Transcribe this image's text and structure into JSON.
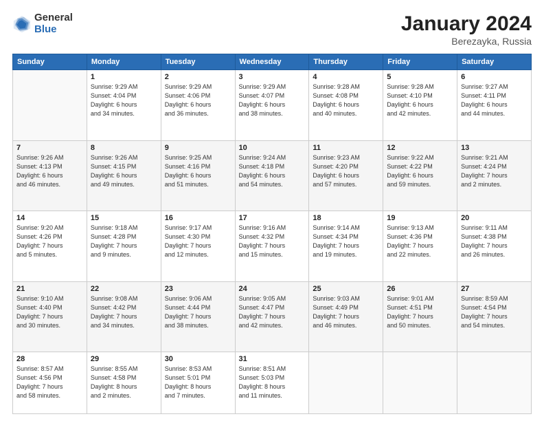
{
  "header": {
    "logo_general": "General",
    "logo_blue": "Blue",
    "title": "January 2024",
    "location": "Berezayka, Russia"
  },
  "days_of_week": [
    "Sunday",
    "Monday",
    "Tuesday",
    "Wednesday",
    "Thursday",
    "Friday",
    "Saturday"
  ],
  "weeks": [
    [
      {
        "day": "",
        "info": ""
      },
      {
        "day": "1",
        "info": "Sunrise: 9:29 AM\nSunset: 4:04 PM\nDaylight: 6 hours\nand 34 minutes."
      },
      {
        "day": "2",
        "info": "Sunrise: 9:29 AM\nSunset: 4:06 PM\nDaylight: 6 hours\nand 36 minutes."
      },
      {
        "day": "3",
        "info": "Sunrise: 9:29 AM\nSunset: 4:07 PM\nDaylight: 6 hours\nand 38 minutes."
      },
      {
        "day": "4",
        "info": "Sunrise: 9:28 AM\nSunset: 4:08 PM\nDaylight: 6 hours\nand 40 minutes."
      },
      {
        "day": "5",
        "info": "Sunrise: 9:28 AM\nSunset: 4:10 PM\nDaylight: 6 hours\nand 42 minutes."
      },
      {
        "day": "6",
        "info": "Sunrise: 9:27 AM\nSunset: 4:11 PM\nDaylight: 6 hours\nand 44 minutes."
      }
    ],
    [
      {
        "day": "7",
        "info": "Sunrise: 9:26 AM\nSunset: 4:13 PM\nDaylight: 6 hours\nand 46 minutes."
      },
      {
        "day": "8",
        "info": "Sunrise: 9:26 AM\nSunset: 4:15 PM\nDaylight: 6 hours\nand 49 minutes."
      },
      {
        "day": "9",
        "info": "Sunrise: 9:25 AM\nSunset: 4:16 PM\nDaylight: 6 hours\nand 51 minutes."
      },
      {
        "day": "10",
        "info": "Sunrise: 9:24 AM\nSunset: 4:18 PM\nDaylight: 6 hours\nand 54 minutes."
      },
      {
        "day": "11",
        "info": "Sunrise: 9:23 AM\nSunset: 4:20 PM\nDaylight: 6 hours\nand 57 minutes."
      },
      {
        "day": "12",
        "info": "Sunrise: 9:22 AM\nSunset: 4:22 PM\nDaylight: 6 hours\nand 59 minutes."
      },
      {
        "day": "13",
        "info": "Sunrise: 9:21 AM\nSunset: 4:24 PM\nDaylight: 7 hours\nand 2 minutes."
      }
    ],
    [
      {
        "day": "14",
        "info": "Sunrise: 9:20 AM\nSunset: 4:26 PM\nDaylight: 7 hours\nand 5 minutes."
      },
      {
        "day": "15",
        "info": "Sunrise: 9:18 AM\nSunset: 4:28 PM\nDaylight: 7 hours\nand 9 minutes."
      },
      {
        "day": "16",
        "info": "Sunrise: 9:17 AM\nSunset: 4:30 PM\nDaylight: 7 hours\nand 12 minutes."
      },
      {
        "day": "17",
        "info": "Sunrise: 9:16 AM\nSunset: 4:32 PM\nDaylight: 7 hours\nand 15 minutes."
      },
      {
        "day": "18",
        "info": "Sunrise: 9:14 AM\nSunset: 4:34 PM\nDaylight: 7 hours\nand 19 minutes."
      },
      {
        "day": "19",
        "info": "Sunrise: 9:13 AM\nSunset: 4:36 PM\nDaylight: 7 hours\nand 22 minutes."
      },
      {
        "day": "20",
        "info": "Sunrise: 9:11 AM\nSunset: 4:38 PM\nDaylight: 7 hours\nand 26 minutes."
      }
    ],
    [
      {
        "day": "21",
        "info": "Sunrise: 9:10 AM\nSunset: 4:40 PM\nDaylight: 7 hours\nand 30 minutes."
      },
      {
        "day": "22",
        "info": "Sunrise: 9:08 AM\nSunset: 4:42 PM\nDaylight: 7 hours\nand 34 minutes."
      },
      {
        "day": "23",
        "info": "Sunrise: 9:06 AM\nSunset: 4:44 PM\nDaylight: 7 hours\nand 38 minutes."
      },
      {
        "day": "24",
        "info": "Sunrise: 9:05 AM\nSunset: 4:47 PM\nDaylight: 7 hours\nand 42 minutes."
      },
      {
        "day": "25",
        "info": "Sunrise: 9:03 AM\nSunset: 4:49 PM\nDaylight: 7 hours\nand 46 minutes."
      },
      {
        "day": "26",
        "info": "Sunrise: 9:01 AM\nSunset: 4:51 PM\nDaylight: 7 hours\nand 50 minutes."
      },
      {
        "day": "27",
        "info": "Sunrise: 8:59 AM\nSunset: 4:54 PM\nDaylight: 7 hours\nand 54 minutes."
      }
    ],
    [
      {
        "day": "28",
        "info": "Sunrise: 8:57 AM\nSunset: 4:56 PM\nDaylight: 7 hours\nand 58 minutes."
      },
      {
        "day": "29",
        "info": "Sunrise: 8:55 AM\nSunset: 4:58 PM\nDaylight: 8 hours\nand 2 minutes."
      },
      {
        "day": "30",
        "info": "Sunrise: 8:53 AM\nSunset: 5:01 PM\nDaylight: 8 hours\nand 7 minutes."
      },
      {
        "day": "31",
        "info": "Sunrise: 8:51 AM\nSunset: 5:03 PM\nDaylight: 8 hours\nand 11 minutes."
      },
      {
        "day": "",
        "info": ""
      },
      {
        "day": "",
        "info": ""
      },
      {
        "day": "",
        "info": ""
      }
    ]
  ]
}
